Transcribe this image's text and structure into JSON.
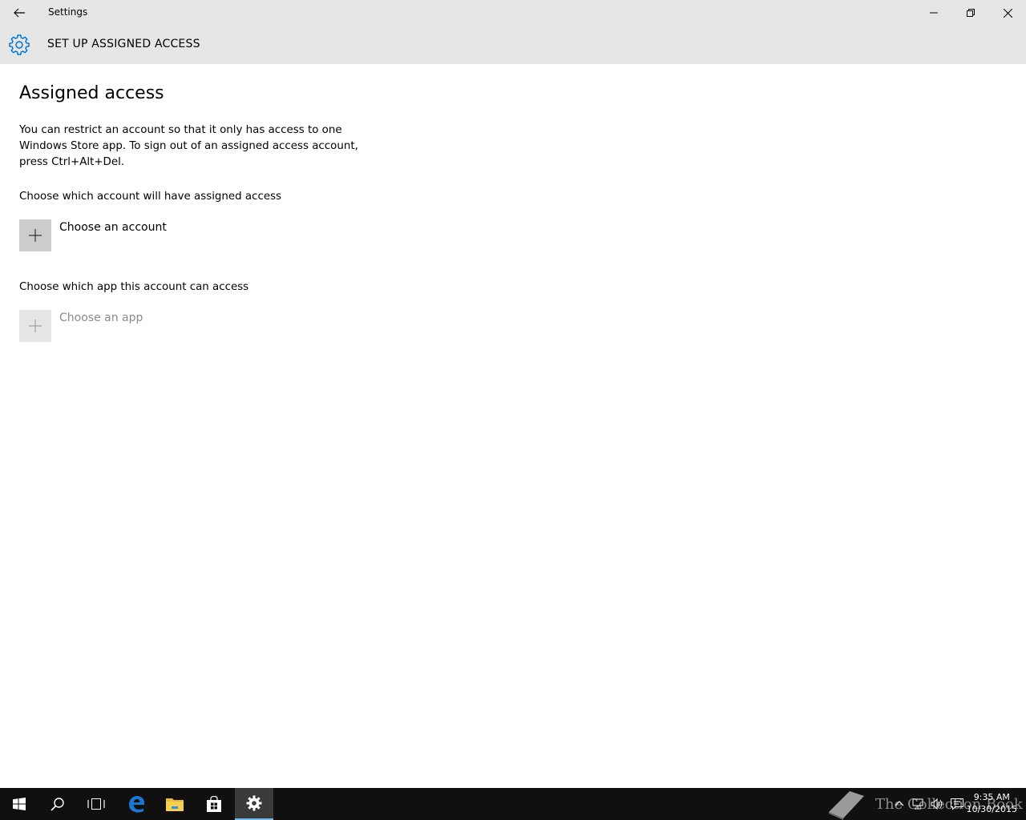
{
  "window": {
    "title": "Settings"
  },
  "header": {
    "title": "SET UP ASSIGNED ACCESS"
  },
  "main": {
    "page_title": "Assigned access",
    "description": "You can restrict an account so that it only has access to one Windows Store app. To sign out of an assigned access account, press Ctrl+Alt+Del.",
    "account_section_label": "Choose which account will have assigned access",
    "choose_account_label": "Choose an account",
    "app_section_label": "Choose which app this account can access",
    "choose_app_label": "Choose an app"
  },
  "taskbar": {
    "items": [
      "start-icon",
      "search-icon",
      "task-view-icon",
      "edge-icon",
      "file-explorer-icon",
      "store-icon",
      "settings-icon"
    ],
    "watermark": "The Collection Book",
    "clock_time": "9:35 AM",
    "clock_date": "10/30/2015"
  },
  "colors": {
    "accent": "#0078d7",
    "header_bg": "#e6e6e6",
    "taskbar_bg": "#101010"
  }
}
